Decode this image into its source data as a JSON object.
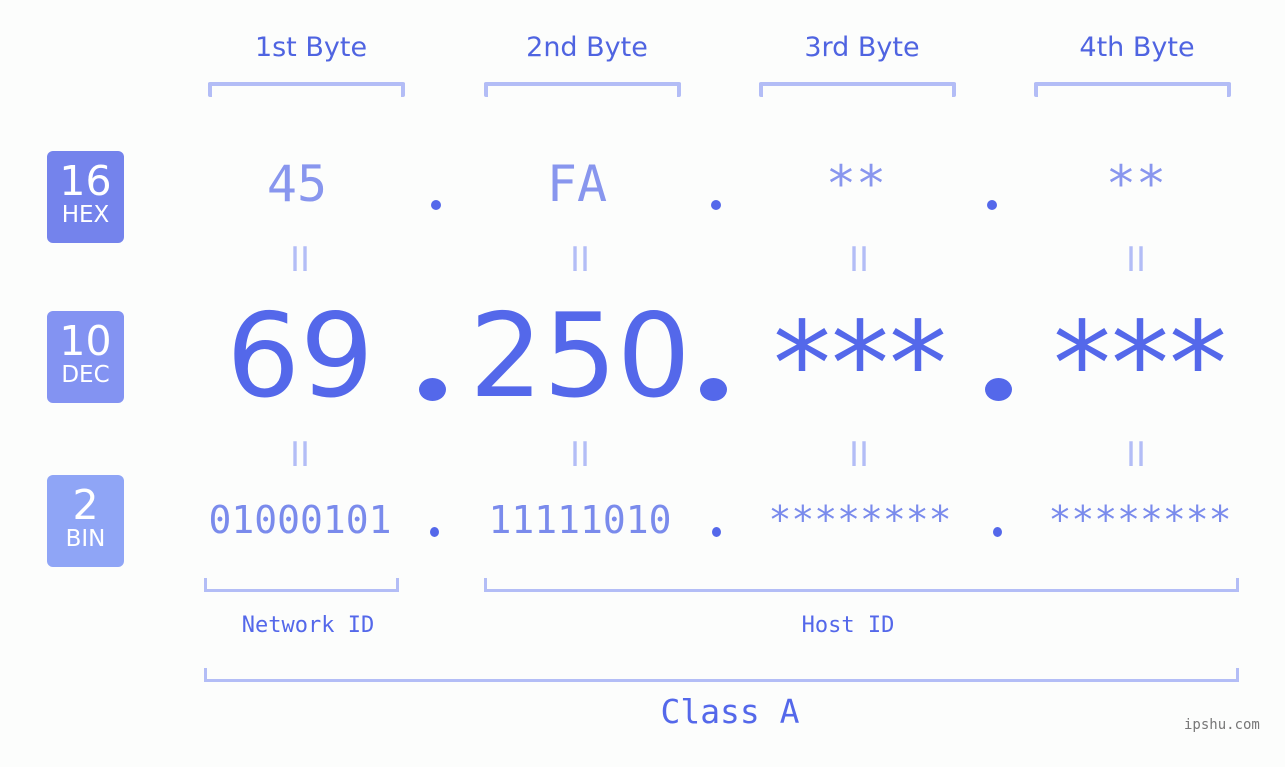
{
  "headers": [
    "1st Byte",
    "2nd Byte",
    "3rd Byte",
    "4th Byte"
  ],
  "badges": {
    "hex": {
      "num": "16",
      "label": "HEX",
      "color": "#7483ec"
    },
    "dec": {
      "num": "10",
      "label": "DEC",
      "color": "#8393f2"
    },
    "bin": {
      "num": "2",
      "label": "BIN",
      "color": "#8fa5f6"
    }
  },
  "hex": [
    "45",
    "FA",
    "**",
    "**"
  ],
  "dec": [
    "69",
    "250",
    "***",
    "***"
  ],
  "bin": [
    "01000101",
    "11111010",
    "********",
    "********"
  ],
  "equals_sign": "II",
  "segments": {
    "network": "Network ID",
    "host": "Host ID"
  },
  "class_label": "Class A",
  "watermark": "ipshu.com"
}
